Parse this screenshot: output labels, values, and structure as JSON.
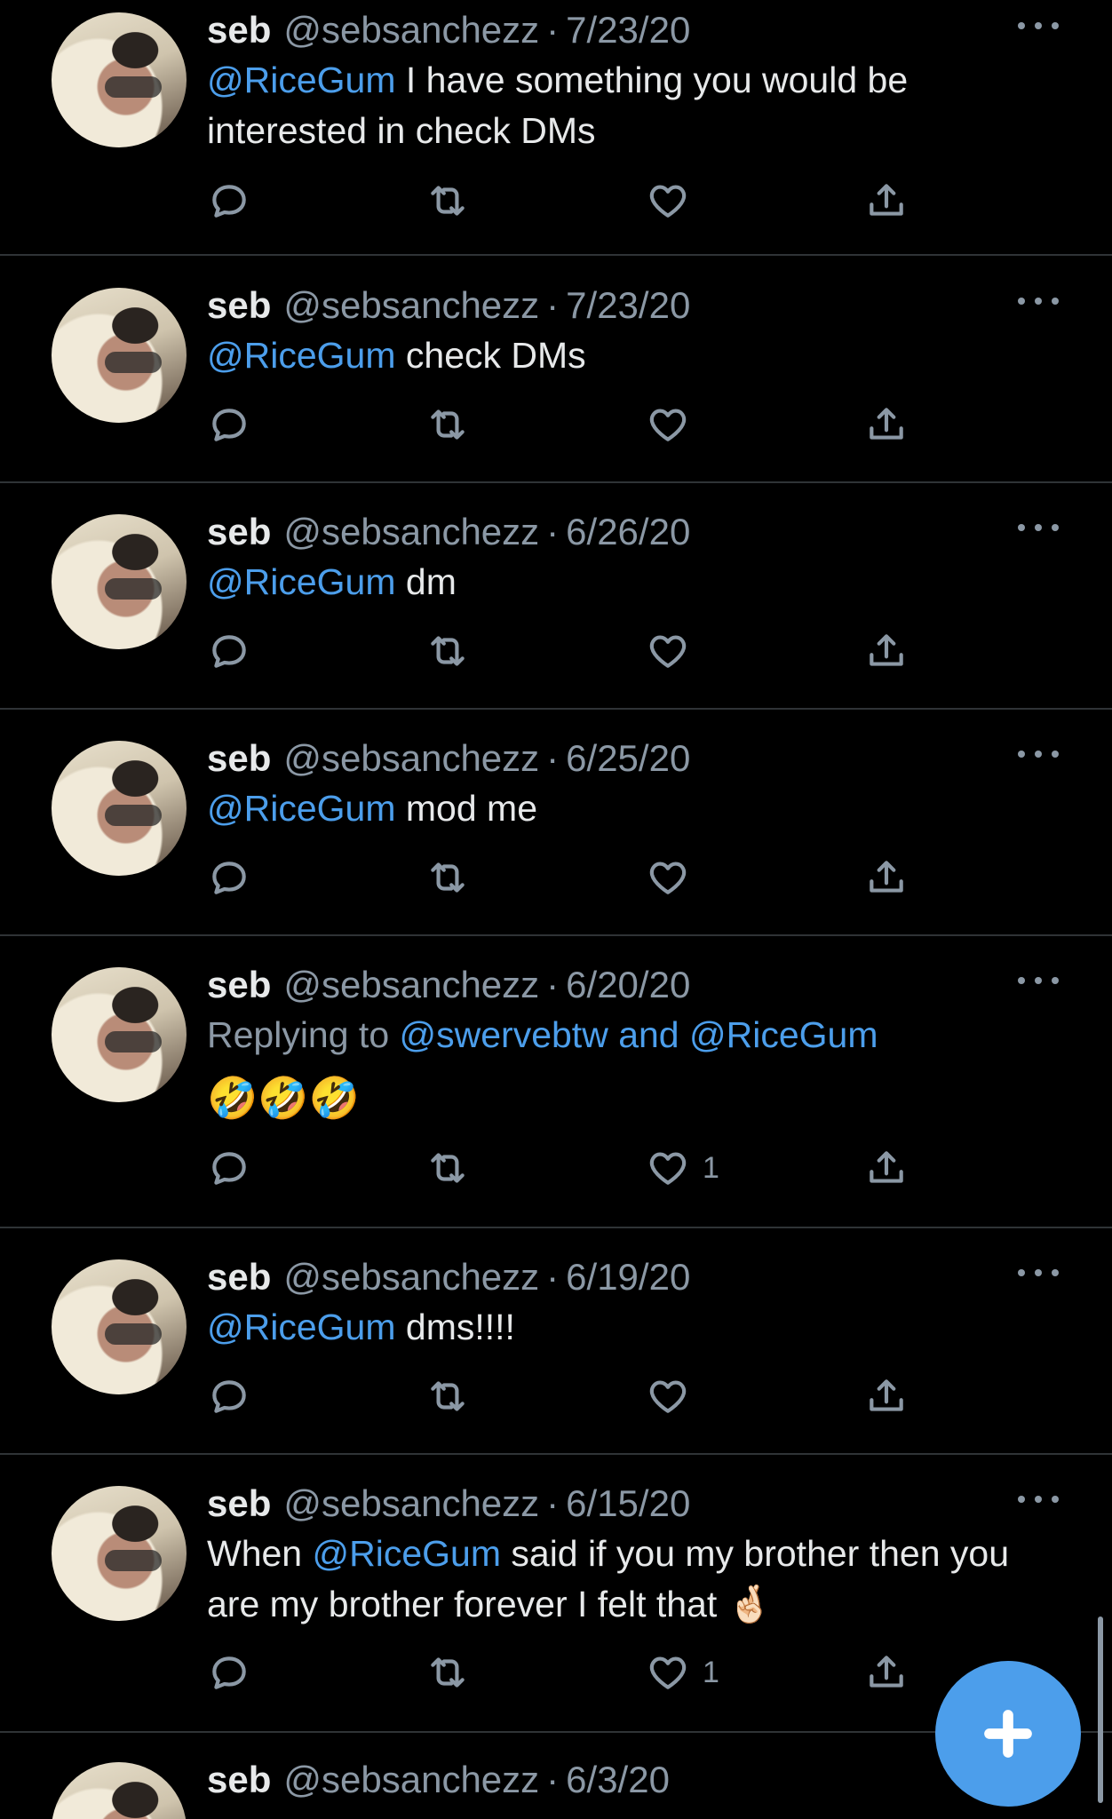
{
  "colors": {
    "background": "#000000",
    "accent": "#4c9eeb",
    "muted": "#8b98a5",
    "divider": "#2f3336"
  },
  "icons": {
    "reply": "reply-icon",
    "retweet": "retweet-icon",
    "like": "heart-icon",
    "share": "share-icon",
    "more": "more-options-icon",
    "compose": "plus-icon"
  },
  "tweets": [
    {
      "name": "seb",
      "handle": "@sebsanchezz",
      "separator": "·",
      "date": "7/23/20",
      "mention": "@RiceGum",
      "text": " I have something you would be interested in check DMs",
      "like_count": ""
    },
    {
      "name": "seb",
      "handle": "@sebsanchezz",
      "separator": "·",
      "date": "7/23/20",
      "mention": "@RiceGum",
      "text": " check DMs",
      "like_count": ""
    },
    {
      "name": "seb",
      "handle": "@sebsanchezz",
      "separator": "·",
      "date": "6/26/20",
      "mention": "@RiceGum",
      "text": " dm",
      "like_count": ""
    },
    {
      "name": "seb",
      "handle": "@sebsanchezz",
      "separator": "·",
      "date": "6/25/20",
      "mention": "@RiceGum",
      "text": " mod me",
      "like_count": ""
    },
    {
      "name": "seb",
      "handle": "@sebsanchezz",
      "separator": "·",
      "date": "6/20/20",
      "replying_prefix": "Replying to ",
      "replying_user_1": "@swervebtw",
      "replying_and": " and ",
      "replying_user_2": "@RiceGum",
      "text": "🤣🤣🤣",
      "like_count": "1"
    },
    {
      "name": "seb",
      "handle": "@sebsanchezz",
      "separator": "·",
      "date": "6/19/20",
      "mention": "@RiceGum",
      "text": " dms!!!!",
      "like_count": ""
    },
    {
      "name": "seb",
      "handle": "@sebsanchezz",
      "separator": "·",
      "date": "6/15/20",
      "text_before": "When ",
      "mention": "@RiceGum",
      "text": "  said if you my brother then you are my brother forever I felt that 🤞🏻",
      "like_count": "1"
    },
    {
      "name": "seb",
      "handle": "@sebsanchezz",
      "separator": "·",
      "date": "6/3/20"
    }
  ]
}
